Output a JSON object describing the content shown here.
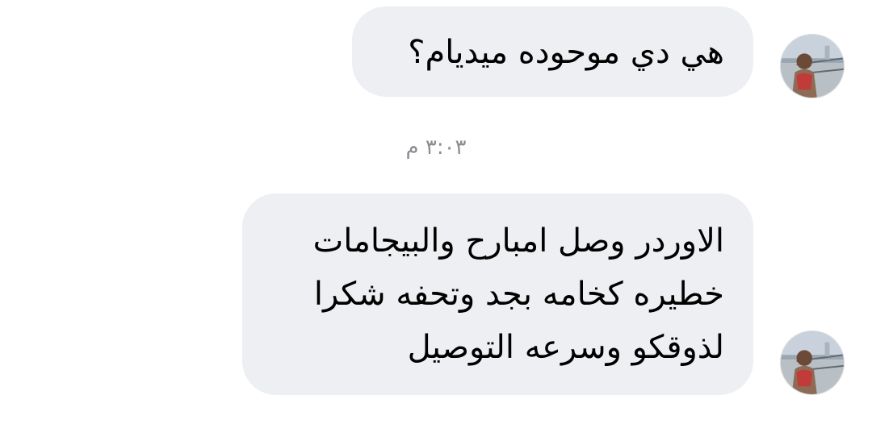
{
  "messages": [
    {
      "text": "هي دي موحوده ميديام؟",
      "avatar_icon": "profile-photo-icon"
    },
    {
      "lines": [
        "الاوردر وصل امبارح والبيجامات",
        "خطيره كخامه بجد وتحفه شكرا",
        "لذوقكو وسرعه التوصيل"
      ],
      "avatar_icon": "profile-photo-icon"
    }
  ],
  "timestamp": "٣:٠٣ م",
  "colors": {
    "bubble_background": "#eeeff2",
    "message_text": "#000000",
    "timestamp_text": "#8a8d91",
    "page_background": "#ffffff"
  }
}
